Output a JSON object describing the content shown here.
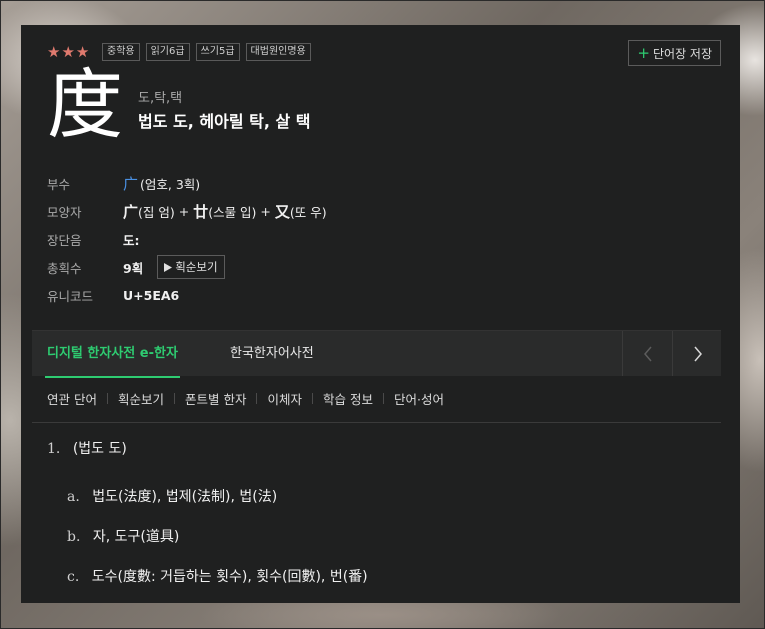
{
  "entry": {
    "stars": "★★★",
    "badges": [
      "중학용",
      "읽기6급",
      "쓰기5급",
      "대법원인명용"
    ],
    "save_label": "단어장 저장",
    "hanja": "度",
    "readings": "도,탁,택",
    "meaning": "법도 도, 헤아릴 탁, 살 택"
  },
  "info": {
    "radical_label": "부수",
    "radical_char": "广",
    "radical_desc": "(엄호, 3획)",
    "shape_label": "모양자",
    "shape_parts": [
      {
        "char": "广",
        "desc": "(집 엄)"
      },
      {
        "char": "廿",
        "desc": "(스물 입)"
      },
      {
        "char": "又",
        "desc": "(또 우)"
      }
    ],
    "length_label": "장단음",
    "length_value": "도:",
    "strokes_label": "총획수",
    "strokes_value": "9획",
    "strokes_button": "획순보기",
    "unicode_label": "유니코드",
    "unicode_value": "U+5EA6"
  },
  "tabs": {
    "active": "디지털 한자사전 e-한자",
    "second": "한국한자어사전"
  },
  "subnav": [
    "연관 단어",
    "획순보기",
    "폰트별 한자",
    "이체자",
    "학습 정보",
    "단어·성어"
  ],
  "definitions": {
    "main_marker": "1.",
    "main_text": "(법도 도)",
    "subs": [
      {
        "marker": "a.",
        "text": "법도(法度), 법제(法制), 법(法)"
      },
      {
        "marker": "b.",
        "text": "자, 도구(道具)"
      },
      {
        "marker": "c.",
        "text": "도수(度數: 거듭하는 횟수), 횟수(回數), 번(番)"
      }
    ]
  },
  "colors": {
    "accent_green": "#2ecc71",
    "star": "#e07a6e",
    "radical_blue": "#4a90e2",
    "panel": "#1f2020"
  }
}
